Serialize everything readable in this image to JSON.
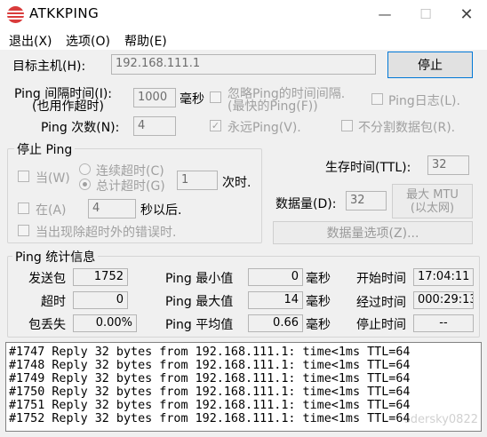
{
  "window": {
    "title": "ATKKPING"
  },
  "menu": [
    "退出(X)",
    "选项(O)",
    "帮助(E)"
  ],
  "target": {
    "label": "目标主机(H):",
    "value": "192.168.111.1",
    "stop_button": "停止"
  },
  "interval": {
    "label_line1": "Ping 间隔时间(I):",
    "label_line2": "(也用作超时)",
    "value": "1000",
    "unit": "毫秒",
    "ignore_label_line1": "忽略Ping的时间间隔.",
    "ignore_label_line2": "(最快的Ping(F))",
    "log_label": "Ping日志(L)."
  },
  "count": {
    "label": "Ping 次数(N):",
    "value": "4",
    "forever_label": "永远Ping(V).",
    "nofrag_label": "不分割数据包(R)."
  },
  "stop_group": {
    "title": "停止 Ping",
    "when_label": "当(W)",
    "consecutive_label": "连续超时(C)",
    "total_label": "总计超时(G)",
    "timeout_value": "1",
    "times_unit": "次时.",
    "at_label": "在(A)",
    "at_value": "4",
    "seconds_label": "秒以后.",
    "error_label": "当出现除超时外的错误时."
  },
  "ttl": {
    "label": "生存时间(TTL):",
    "value": "32"
  },
  "data_size": {
    "label": "数据量(D):",
    "value": "32",
    "max_mtu": "最大 MTU",
    "max_mtu_sub": "(以太网)",
    "options_button": "数据量选项(Z)..."
  },
  "stats": {
    "title": "Ping 统计信息",
    "sent_label": "发送包",
    "sent": "1752",
    "timeout_label": "超时",
    "timeout": "0",
    "loss_label": "包丢失",
    "loss": "0.00%",
    "min_label": "Ping 最小值",
    "min": "0",
    "max_label": "Ping 最大值",
    "max": "14",
    "avg_label": "Ping 平均值",
    "avg": "0.66",
    "ms": "毫秒",
    "start_label": "开始时间",
    "start": "17:04:11",
    "elapsed_label": "经过时间",
    "elapsed": "000:29:13",
    "stop_label": "停止时间",
    "stop": "--"
  },
  "log": [
    "#1747 Reply 32 bytes from 192.168.111.1: time<1ms TTL=64",
    "#1748 Reply 32 bytes from 192.168.111.1: time<1ms TTL=64",
    "#1749 Reply 32 bytes from 192.168.111.1: time<1ms TTL=64",
    "#1750 Reply 32 bytes from 192.168.111.1: time<1ms TTL=64",
    "#1751 Reply 32 bytes from 192.168.111.1: time<1ms TTL=64",
    "#1752 Reply 32 bytes from 192.168.111.1: time<1ms TTL=64"
  ],
  "watermark": "sdersky0822"
}
